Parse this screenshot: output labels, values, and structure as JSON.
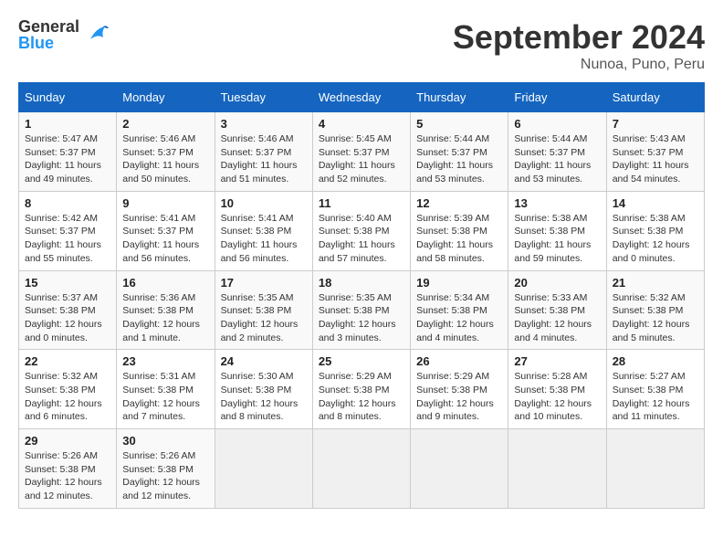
{
  "header": {
    "logo": {
      "line1": "General",
      "line2": "Blue"
    },
    "month": "September 2024",
    "location": "Nunoa, Puno, Peru"
  },
  "weekdays": [
    "Sunday",
    "Monday",
    "Tuesday",
    "Wednesday",
    "Thursday",
    "Friday",
    "Saturday"
  ],
  "weeks": [
    [
      {
        "day": "1",
        "sunrise": "5:47 AM",
        "sunset": "5:37 PM",
        "daylight": "11 hours and 49 minutes."
      },
      {
        "day": "2",
        "sunrise": "5:46 AM",
        "sunset": "5:37 PM",
        "daylight": "11 hours and 50 minutes."
      },
      {
        "day": "3",
        "sunrise": "5:46 AM",
        "sunset": "5:37 PM",
        "daylight": "11 hours and 51 minutes."
      },
      {
        "day": "4",
        "sunrise": "5:45 AM",
        "sunset": "5:37 PM",
        "daylight": "11 hours and 52 minutes."
      },
      {
        "day": "5",
        "sunrise": "5:44 AM",
        "sunset": "5:37 PM",
        "daylight": "11 hours and 53 minutes."
      },
      {
        "day": "6",
        "sunrise": "5:44 AM",
        "sunset": "5:37 PM",
        "daylight": "11 hours and 53 minutes."
      },
      {
        "day": "7",
        "sunrise": "5:43 AM",
        "sunset": "5:37 PM",
        "daylight": "11 hours and 54 minutes."
      }
    ],
    [
      {
        "day": "8",
        "sunrise": "5:42 AM",
        "sunset": "5:37 PM",
        "daylight": "11 hours and 55 minutes."
      },
      {
        "day": "9",
        "sunrise": "5:41 AM",
        "sunset": "5:37 PM",
        "daylight": "11 hours and 56 minutes."
      },
      {
        "day": "10",
        "sunrise": "5:41 AM",
        "sunset": "5:38 PM",
        "daylight": "11 hours and 56 minutes."
      },
      {
        "day": "11",
        "sunrise": "5:40 AM",
        "sunset": "5:38 PM",
        "daylight": "11 hours and 57 minutes."
      },
      {
        "day": "12",
        "sunrise": "5:39 AM",
        "sunset": "5:38 PM",
        "daylight": "11 hours and 58 minutes."
      },
      {
        "day": "13",
        "sunrise": "5:38 AM",
        "sunset": "5:38 PM",
        "daylight": "11 hours and 59 minutes."
      },
      {
        "day": "14",
        "sunrise": "5:38 AM",
        "sunset": "5:38 PM",
        "daylight": "12 hours and 0 minutes."
      }
    ],
    [
      {
        "day": "15",
        "sunrise": "5:37 AM",
        "sunset": "5:38 PM",
        "daylight": "12 hours and 0 minutes."
      },
      {
        "day": "16",
        "sunrise": "5:36 AM",
        "sunset": "5:38 PM",
        "daylight": "12 hours and 1 minute."
      },
      {
        "day": "17",
        "sunrise": "5:35 AM",
        "sunset": "5:38 PM",
        "daylight": "12 hours and 2 minutes."
      },
      {
        "day": "18",
        "sunrise": "5:35 AM",
        "sunset": "5:38 PM",
        "daylight": "12 hours and 3 minutes."
      },
      {
        "day": "19",
        "sunrise": "5:34 AM",
        "sunset": "5:38 PM",
        "daylight": "12 hours and 4 minutes."
      },
      {
        "day": "20",
        "sunrise": "5:33 AM",
        "sunset": "5:38 PM",
        "daylight": "12 hours and 4 minutes."
      },
      {
        "day": "21",
        "sunrise": "5:32 AM",
        "sunset": "5:38 PM",
        "daylight": "12 hours and 5 minutes."
      }
    ],
    [
      {
        "day": "22",
        "sunrise": "5:32 AM",
        "sunset": "5:38 PM",
        "daylight": "12 hours and 6 minutes."
      },
      {
        "day": "23",
        "sunrise": "5:31 AM",
        "sunset": "5:38 PM",
        "daylight": "12 hours and 7 minutes."
      },
      {
        "day": "24",
        "sunrise": "5:30 AM",
        "sunset": "5:38 PM",
        "daylight": "12 hours and 8 minutes."
      },
      {
        "day": "25",
        "sunrise": "5:29 AM",
        "sunset": "5:38 PM",
        "daylight": "12 hours and 8 minutes."
      },
      {
        "day": "26",
        "sunrise": "5:29 AM",
        "sunset": "5:38 PM",
        "daylight": "12 hours and 9 minutes."
      },
      {
        "day": "27",
        "sunrise": "5:28 AM",
        "sunset": "5:38 PM",
        "daylight": "12 hours and 10 minutes."
      },
      {
        "day": "28",
        "sunrise": "5:27 AM",
        "sunset": "5:38 PM",
        "daylight": "12 hours and 11 minutes."
      }
    ],
    [
      {
        "day": "29",
        "sunrise": "5:26 AM",
        "sunset": "5:38 PM",
        "daylight": "12 hours and 12 minutes."
      },
      {
        "day": "30",
        "sunrise": "5:26 AM",
        "sunset": "5:38 PM",
        "daylight": "12 hours and 12 minutes."
      },
      null,
      null,
      null,
      null,
      null
    ]
  ]
}
